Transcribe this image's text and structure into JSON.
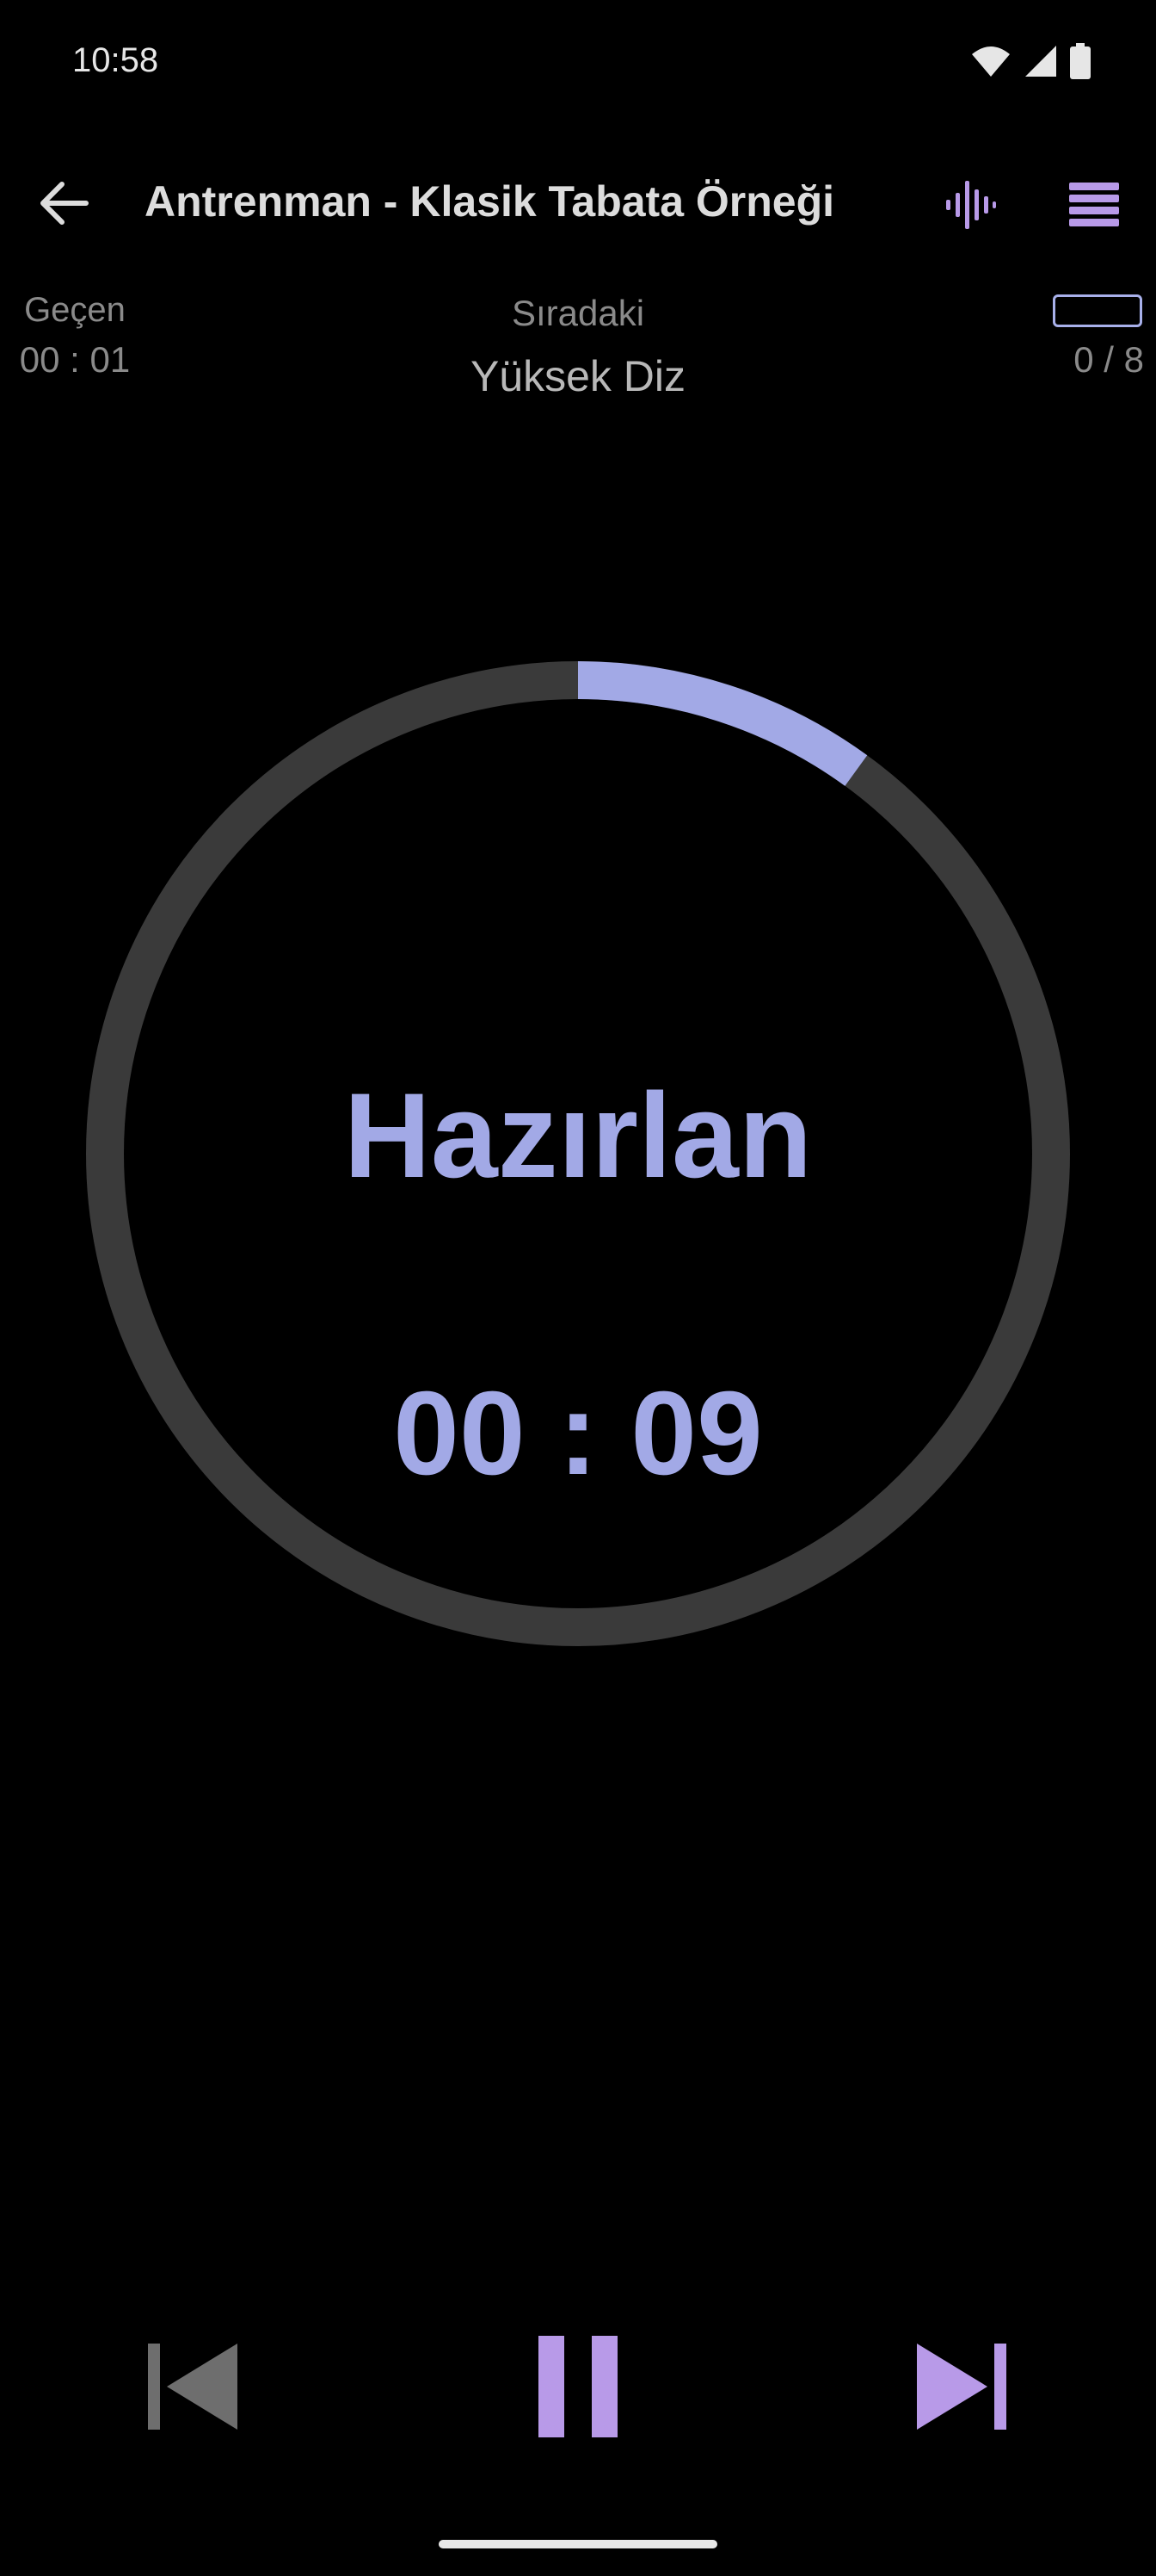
{
  "status_bar": {
    "time": "10:58",
    "icons": [
      "wifi-icon",
      "signal-icon",
      "battery-icon"
    ]
  },
  "app_bar": {
    "title": "Antrenman - Klasik Tabata Örneği",
    "back_icon": "arrow-left-icon",
    "sound_icon": "audio-wave-icon",
    "menu_icon": "menu-icon"
  },
  "info": {
    "elapsed_label": "Geçen",
    "elapsed_value": "00 : 01",
    "next_label": "Sıradaki",
    "next_value": "Yüksek Diz",
    "progress_count": "0 / 8"
  },
  "timer": {
    "phase": "Hazırlan",
    "countdown": "00 : 09",
    "progress_fraction": 0.1
  },
  "controls": {
    "prev_icon": "skip-previous-icon",
    "pause_icon": "pause-icon",
    "next_icon": "skip-next-icon"
  },
  "colors": {
    "accent": "#a2a9e6",
    "accent_purple": "#b89ae8",
    "ring_track": "#3a3a3a",
    "background": "#000000"
  }
}
